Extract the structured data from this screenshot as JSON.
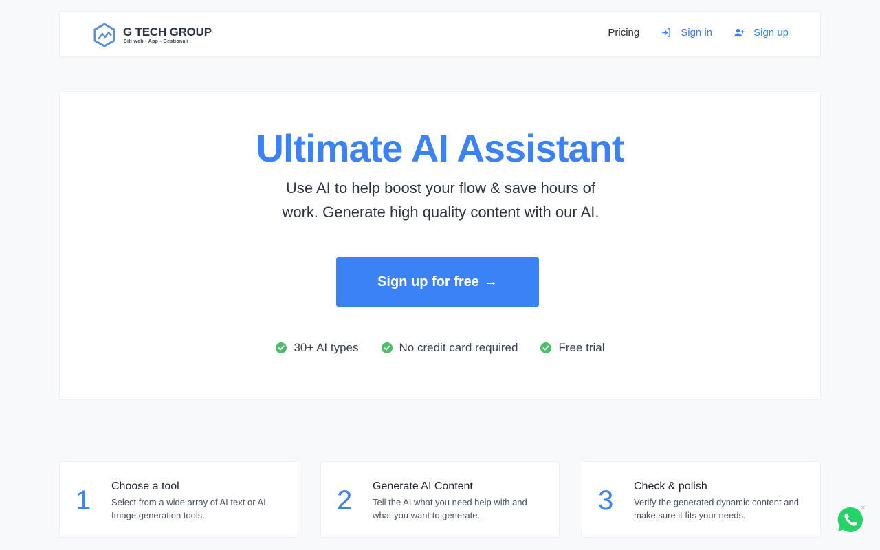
{
  "brand": {
    "name": "G TECH GROUP",
    "tagline": "Siti web - App - Gestionali",
    "color": "#3b82f6"
  },
  "nav": {
    "pricing": "Pricing",
    "signin": "Sign in",
    "signup": "Sign up"
  },
  "hero": {
    "title": "Ultimate AI Assistant",
    "subtitle": "Use AI to help boost your flow & save hours of work. Generate high quality content with our AI.",
    "cta": "Sign up for free",
    "cta_arrow": "→",
    "features": [
      "30+ AI types",
      "No credit card required",
      "Free trial"
    ]
  },
  "steps": [
    {
      "number": "1",
      "title": "Choose a tool",
      "description": "Select from a wide array of AI text or AI Image generation tools."
    },
    {
      "number": "2",
      "title": "Generate AI Content",
      "description": "Tell the AI what you need help with and what you want to generate."
    },
    {
      "number": "3",
      "title": "Check & polish",
      "description": "Verify the generated dynamic content and make sure it fits your needs."
    }
  ],
  "whatsapp": {
    "icon": "whatsapp-icon",
    "close": "×",
    "color": "#25d366"
  }
}
